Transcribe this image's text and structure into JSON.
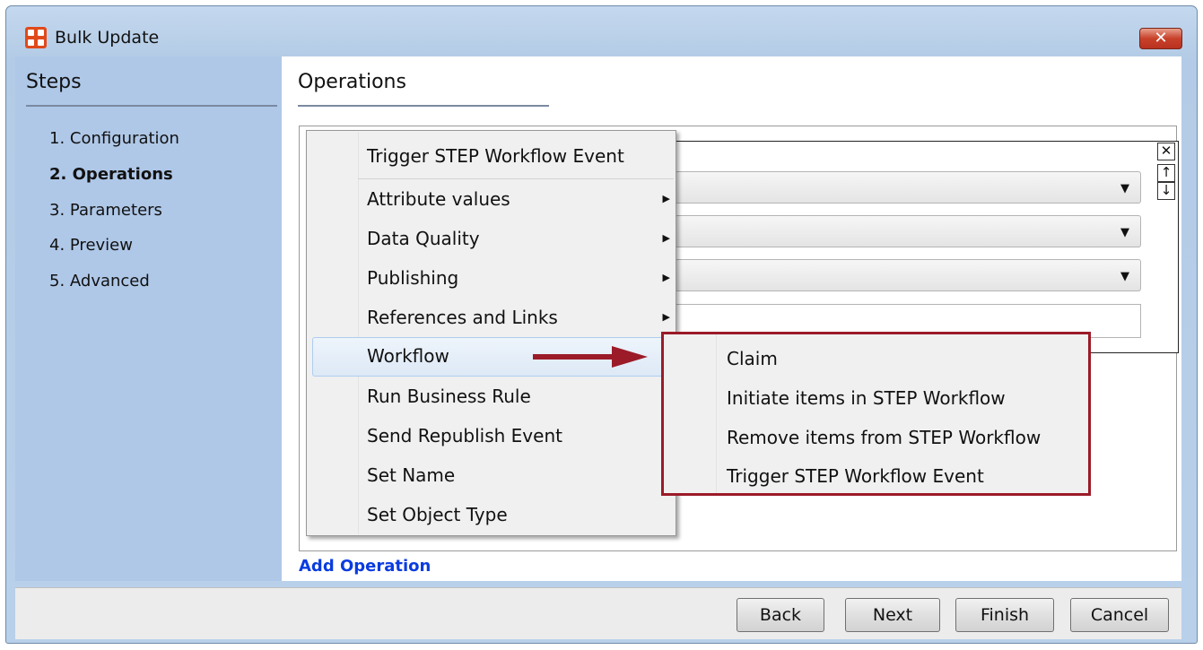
{
  "window": {
    "title": "Bulk Update",
    "close_label": "✕"
  },
  "steps": {
    "title": "Steps",
    "items": [
      "1. Configuration",
      "2. Operations",
      "3. Parameters",
      "4. Preview",
      "5. Advanced"
    ],
    "active_index": 1
  },
  "operations": {
    "title": "Operations",
    "add_label": "Add Operation"
  },
  "context_menu": {
    "items": [
      {
        "label": "Trigger STEP Workflow Event",
        "submenu": false
      },
      {
        "label": "Attribute values",
        "submenu": true
      },
      {
        "label": "Data Quality",
        "submenu": true
      },
      {
        "label": "Publishing",
        "submenu": true
      },
      {
        "label": "References and Links",
        "submenu": true
      },
      {
        "label": "Workflow",
        "submenu": false,
        "highlighted": true
      },
      {
        "label": "Run Business Rule",
        "submenu": false
      },
      {
        "label": "Send Republish Event",
        "submenu": false
      },
      {
        "label": "Set Name",
        "submenu": false
      },
      {
        "label": "Set Object Type",
        "submenu": false
      }
    ]
  },
  "submenu": {
    "items": [
      "Claim",
      "Initiate items in STEP Workflow",
      "Remove items from STEP Workflow",
      "Trigger STEP Workflow Event"
    ]
  },
  "footer": {
    "back": "Back",
    "next": "Next",
    "finish": "Finish",
    "cancel": "Cancel"
  },
  "colors": {
    "highlight_border": "#9b1b28",
    "link": "#0a3ce0",
    "steps_bg": "#afc8e8"
  }
}
